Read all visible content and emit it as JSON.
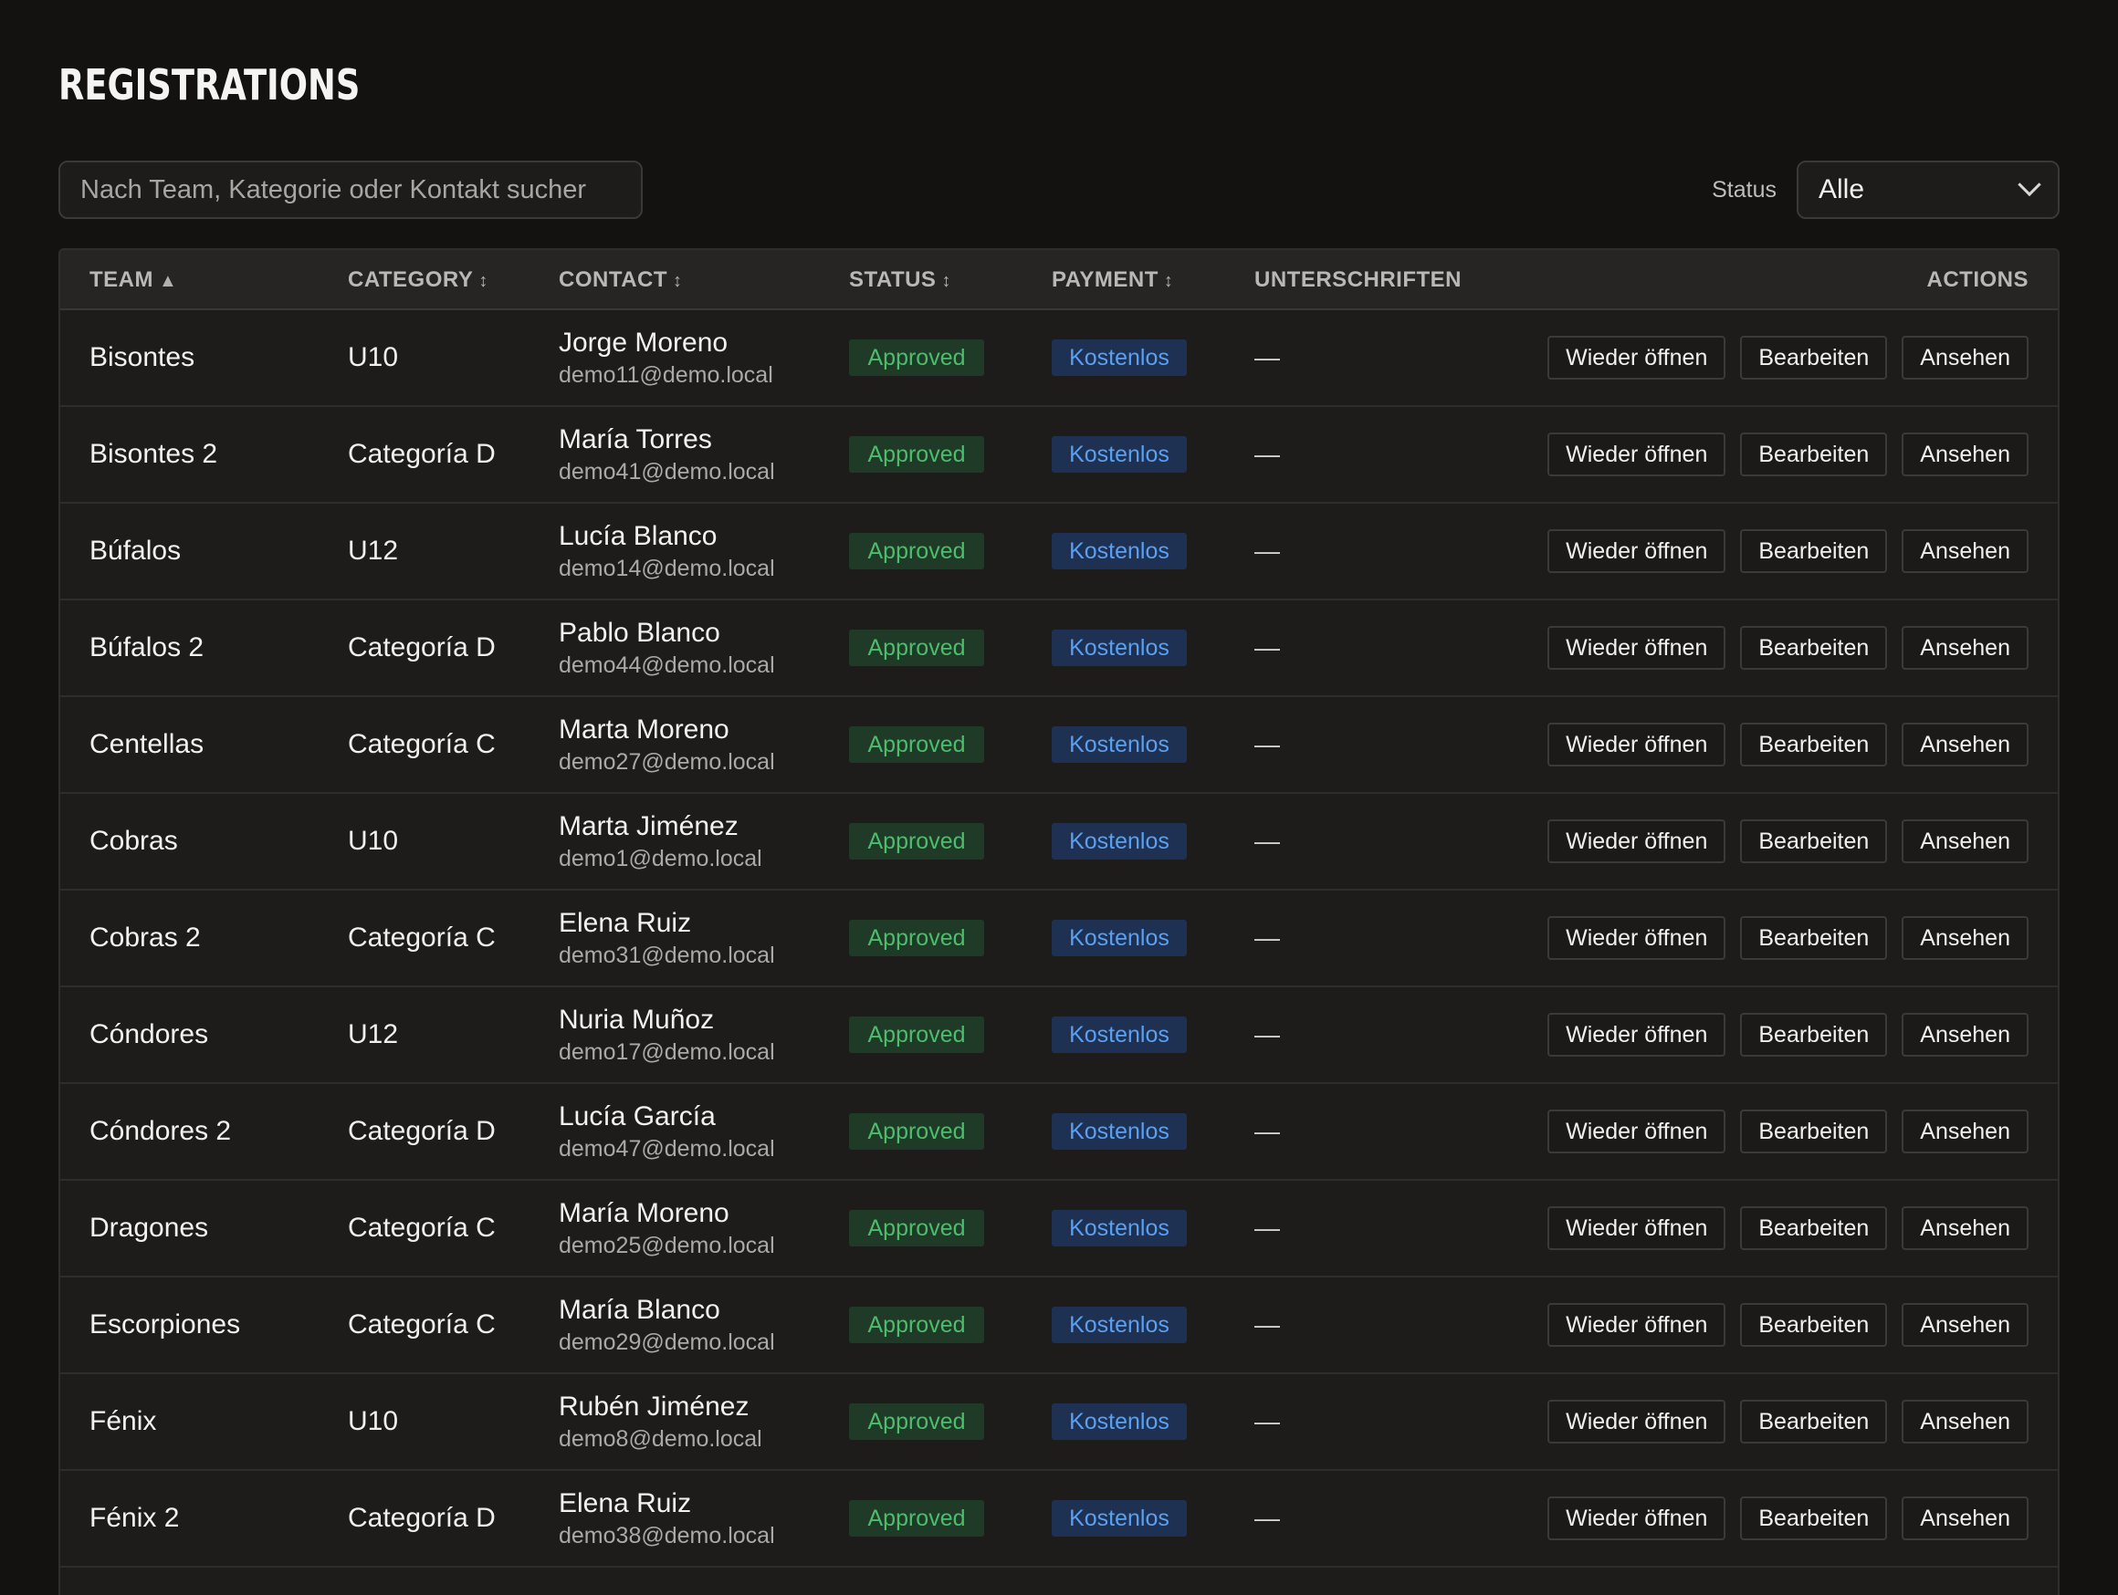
{
  "title": "REGISTRATIONS",
  "search": {
    "placeholder": "Nach Team, Kategorie oder Kontakt sucher"
  },
  "filter": {
    "label": "Status",
    "selected": "Alle"
  },
  "columns": {
    "team": "TEAM",
    "team_sort": "▲",
    "category": "CATEGORY",
    "category_sort": "↕",
    "contact": "CONTACT",
    "contact_sort": "↕",
    "status": "STATUS",
    "status_sort": "↕",
    "payment": "PAYMENT",
    "payment_sort": "↕",
    "signatures": "UNTERSCHRIFTEN",
    "actions": "ACTIONS"
  },
  "action_labels": {
    "reopen": "Wieder öffnen",
    "edit": "Bearbeiten",
    "view": "Ansehen"
  },
  "colors": {
    "approved": "#4cbd6c",
    "free": "#5ba0f0"
  },
  "rows": [
    {
      "team": "Bisontes",
      "category": "U10",
      "name": "Jorge Moreno",
      "email": "demo11@demo.local",
      "status": "Approved",
      "payment": "Kostenlos",
      "signatures": "—"
    },
    {
      "team": "Bisontes 2",
      "category": "Categoría D",
      "name": "María Torres",
      "email": "demo41@demo.local",
      "status": "Approved",
      "payment": "Kostenlos",
      "signatures": "—"
    },
    {
      "team": "Búfalos",
      "category": "U12",
      "name": "Lucía Blanco",
      "email": "demo14@demo.local",
      "status": "Approved",
      "payment": "Kostenlos",
      "signatures": "—"
    },
    {
      "team": "Búfalos 2",
      "category": "Categoría D",
      "name": "Pablo Blanco",
      "email": "demo44@demo.local",
      "status": "Approved",
      "payment": "Kostenlos",
      "signatures": "—"
    },
    {
      "team": "Centellas",
      "category": "Categoría C",
      "name": "Marta Moreno",
      "email": "demo27@demo.local",
      "status": "Approved",
      "payment": "Kostenlos",
      "signatures": "—"
    },
    {
      "team": "Cobras",
      "category": "U10",
      "name": "Marta Jiménez",
      "email": "demo1@demo.local",
      "status": "Approved",
      "payment": "Kostenlos",
      "signatures": "—"
    },
    {
      "team": "Cobras 2",
      "category": "Categoría C",
      "name": "Elena Ruiz",
      "email": "demo31@demo.local",
      "status": "Approved",
      "payment": "Kostenlos",
      "signatures": "—"
    },
    {
      "team": "Cóndores",
      "category": "U12",
      "name": "Nuria Muñoz",
      "email": "demo17@demo.local",
      "status": "Approved",
      "payment": "Kostenlos",
      "signatures": "—"
    },
    {
      "team": "Cóndores 2",
      "category": "Categoría D",
      "name": "Lucía García",
      "email": "demo47@demo.local",
      "status": "Approved",
      "payment": "Kostenlos",
      "signatures": "—"
    },
    {
      "team": "Dragones",
      "category": "Categoría C",
      "name": "María Moreno",
      "email": "demo25@demo.local",
      "status": "Approved",
      "payment": "Kostenlos",
      "signatures": "—"
    },
    {
      "team": "Escorpiones",
      "category": "Categoría C",
      "name": "María Blanco",
      "email": "demo29@demo.local",
      "status": "Approved",
      "payment": "Kostenlos",
      "signatures": "—"
    },
    {
      "team": "Fénix",
      "category": "U10",
      "name": "Rubén Jiménez",
      "email": "demo8@demo.local",
      "status": "Approved",
      "payment": "Kostenlos",
      "signatures": "—"
    },
    {
      "team": "Fénix 2",
      "category": "Categoría D",
      "name": "Elena Ruiz",
      "email": "demo38@demo.local",
      "status": "Approved",
      "payment": "Kostenlos",
      "signatures": "—"
    }
  ]
}
